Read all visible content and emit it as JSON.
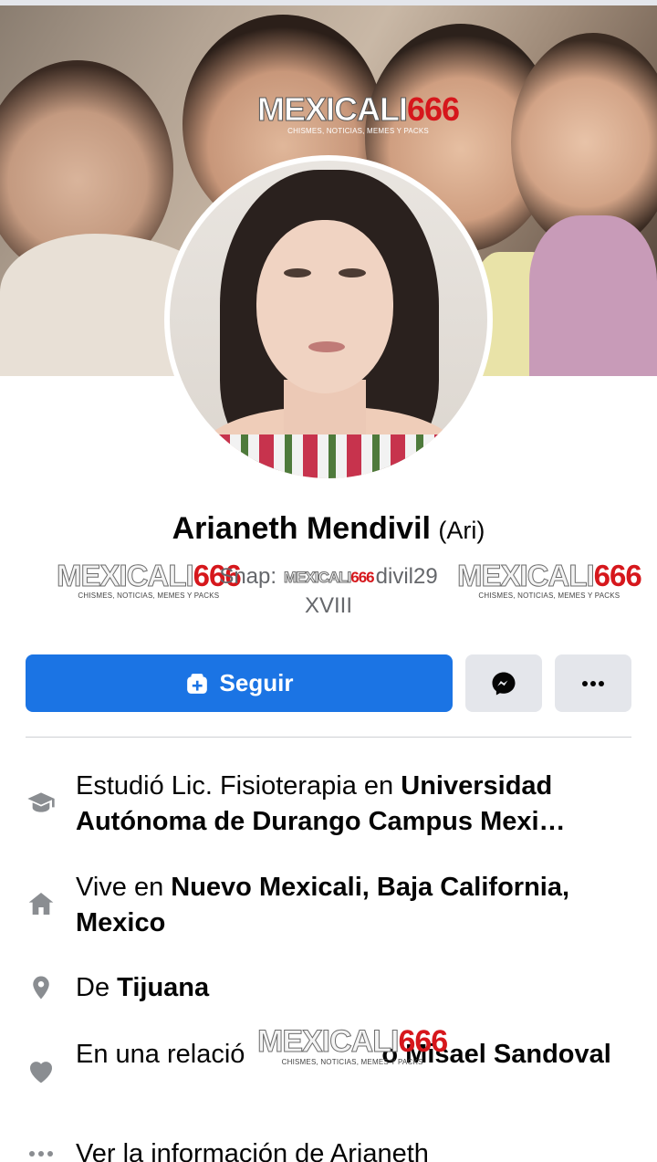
{
  "watermark": {
    "brand_white": "MEXICALI",
    "brand_red": "666",
    "tagline": "CHISMES, NOTICIAS, MEMES Y PACKS"
  },
  "profile": {
    "name": "Arianeth Mendivil",
    "alt_name": "(Ari)",
    "bio_snap_label": "Snap:",
    "bio_snap_suffix": "divil29",
    "bio_line2": "XVIII"
  },
  "actions": {
    "follow_label": "Seguir",
    "follow_icon": "add-friend-icon",
    "message_icon": "messenger-icon",
    "more_icon": "more-horizontal-icon"
  },
  "colors": {
    "primary_blue": "#1b74e4",
    "secondary_button": "#e4e6eb",
    "muted_text": "#65676b",
    "icon_gray": "#8a8d91",
    "watermark_red": "#d6171c"
  },
  "intro": [
    {
      "icon": "graduation-cap-icon",
      "prefix": "Estudió Lic. Fisioterapia en ",
      "bold": "Universidad Autónoma de Durango Campus Mexi…"
    },
    {
      "icon": "home-icon",
      "prefix": "Vive en ",
      "bold": "Nuevo Mexicali, Baja California, Mexico"
    },
    {
      "icon": "location-pin-icon",
      "prefix": "De ",
      "bold": "Tijuana"
    },
    {
      "icon": "heart-icon",
      "prefix": "En una relació",
      "bold": "o Misael Sandoval"
    },
    {
      "icon": "more-horizontal-icon",
      "prefix": "Ver la información de Arianeth",
      "bold": ""
    }
  ]
}
